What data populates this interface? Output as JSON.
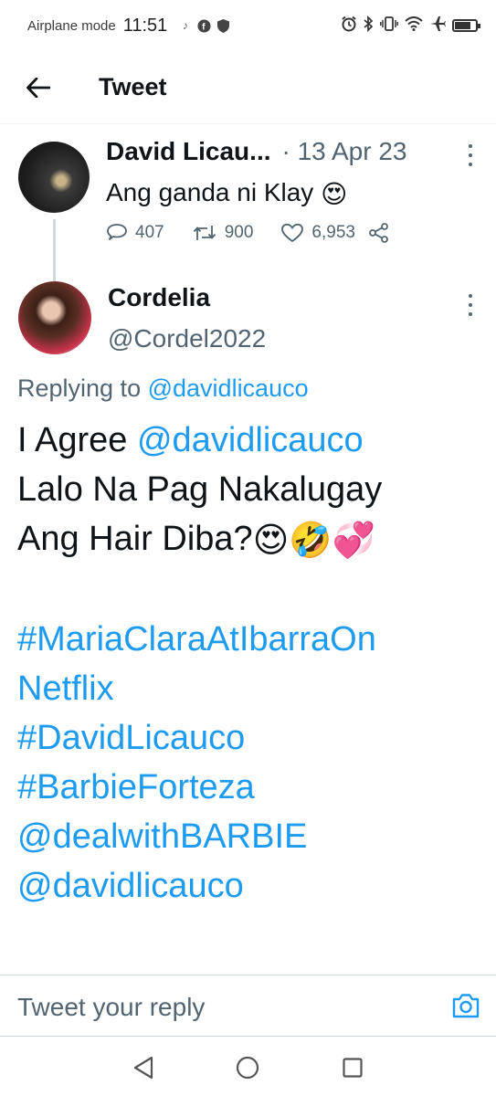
{
  "status_bar": {
    "airplane_mode": "Airplane mode",
    "time": "11:51",
    "left_icons": [
      "tiktok-icon",
      "facebook-icon",
      "shield-icon"
    ],
    "right_icons": [
      "alarm-icon",
      "bluetooth-icon",
      "vibrate-icon",
      "wifi-icon",
      "airplane-icon",
      "battery-icon"
    ]
  },
  "header": {
    "title": "Tweet"
  },
  "parent_tweet": {
    "name": "David Licau...",
    "date": "· 13 Apr 23",
    "text": "Ang ganda ni Klay",
    "emoji": "😍",
    "replies": "407",
    "retweets": "900",
    "likes": "6,953"
  },
  "reply_tweet": {
    "name": "Cordelia",
    "handle": "@Cordel2022",
    "replying_prefix": "Replying to",
    "replying_to": "@davidlicauco",
    "line1_text": "I Agree",
    "line1_mention": "@davidlicauco",
    "line2": "Lalo Na Pag Nakalugay",
    "line3": "Ang Hair Diba?",
    "line3_emojis": "😍🤣💞",
    "hashtag1a": "#MariaClaraAtIbarraOn",
    "hashtag1b": "Netflix",
    "hashtag2": "#DavidLicauco",
    "hashtag3": "#BarbieForteza",
    "mention2": "@dealwithBARBIE",
    "mention3": "@davidlicauco"
  },
  "reply_bar": {
    "placeholder": "Tweet your reply"
  },
  "colors": {
    "accent": "#1d9bf0",
    "text_primary": "#0f1419",
    "text_secondary": "#536471"
  }
}
